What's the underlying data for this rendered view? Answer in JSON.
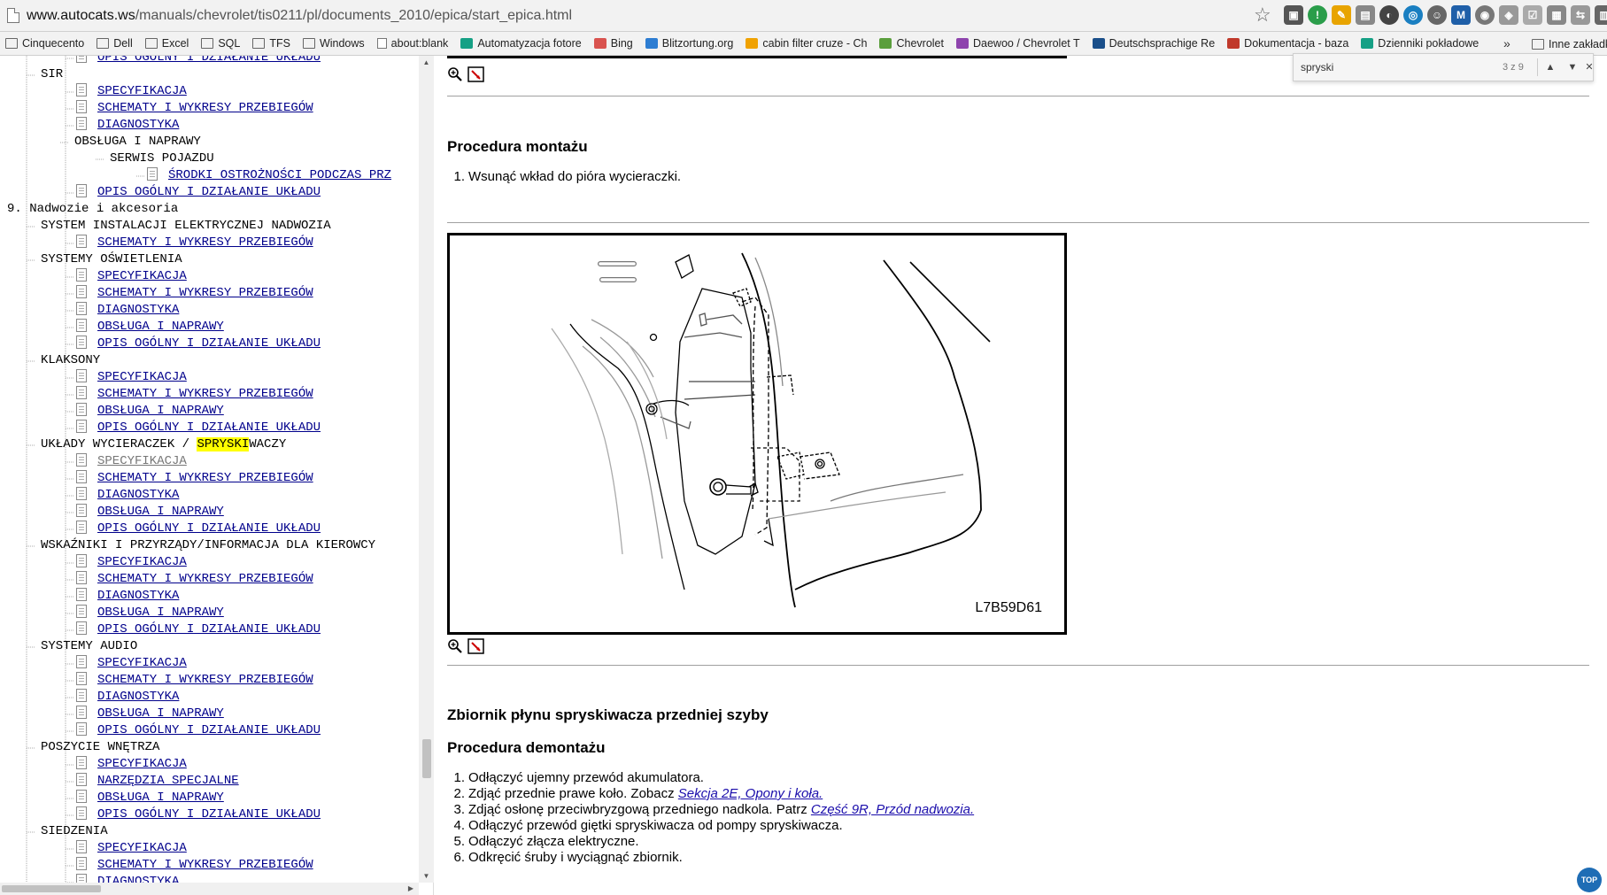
{
  "browser": {
    "url_host": "www.autocats.ws",
    "url_path": "/manuals/chevrolet/tis0211/pl/documents_2010/epica/start_epica.html"
  },
  "bookmarks": {
    "items": [
      {
        "label": "Cinquecento",
        "icon": "folder-icon"
      },
      {
        "label": "Dell",
        "icon": "folder-icon"
      },
      {
        "label": "Excel",
        "icon": "folder-icon"
      },
      {
        "label": "SQL",
        "icon": "folder-icon"
      },
      {
        "label": "TFS",
        "icon": "folder-icon"
      },
      {
        "label": "Windows",
        "icon": "folder-icon"
      },
      {
        "label": "about:blank",
        "icon": "page-icon"
      },
      {
        "label": "Automatyzacja fotore",
        "icon": "site-icon"
      },
      {
        "label": "Bing",
        "icon": "site-icon"
      },
      {
        "label": "Blitzortung.org",
        "icon": "site-icon"
      },
      {
        "label": "cabin filter cruze - Ch",
        "icon": "site-icon"
      },
      {
        "label": "Chevrolet",
        "icon": "site-icon"
      },
      {
        "label": "Daewoo / Chevrolet T",
        "icon": "site-icon"
      },
      {
        "label": "Deutschsprachige Re",
        "icon": "site-icon"
      },
      {
        "label": "Dokumentacja - baza",
        "icon": "site-icon"
      },
      {
        "label": "Dzienniki pokładowe",
        "icon": "site-icon"
      }
    ],
    "more": "»",
    "other": "Inne zakładk"
  },
  "find": {
    "query": "spryski",
    "count": "3 z 9",
    "prev": "▲",
    "next": "▼",
    "close": "✕"
  },
  "tree": {
    "rows": [
      {
        "text": "OPIS OGÓLNY I DZIAŁANIE UKŁADU",
        "link": true
      },
      {
        "text": "SIR",
        "link": false
      },
      {
        "text": "SPECYFIKACJA",
        "link": true
      },
      {
        "text": "SCHEMATY I WYKRESY PRZEBIEGÓW",
        "link": true
      },
      {
        "text": "DIAGNOSTYKA",
        "link": true
      },
      {
        "text": "OBSŁUGA I NAPRAWY",
        "link": false
      },
      {
        "text": "SERWIS POJAZDU",
        "link": false
      },
      {
        "text": "ŚRODKI OSTROŻNOŚCI PODCZAS PRZ",
        "link": true
      },
      {
        "text": "OPIS OGÓLNY I DZIAŁANIE UKŁADU",
        "link": true
      },
      {
        "text": "9. Nadwozie i akcesoria",
        "link": false
      },
      {
        "text": "SYSTEM INSTALACJI ELEKTRYCZNEJ NADWOZIA",
        "link": false
      },
      {
        "text": "SCHEMATY I WYKRESY PRZEBIEGÓW",
        "link": true
      },
      {
        "text": "SYSTEMY OŚWIETLENIA",
        "link": false
      },
      {
        "text": "SPECYFIKACJA",
        "link": true
      },
      {
        "text": "SCHEMATY I WYKRESY PRZEBIEGÓW",
        "link": true
      },
      {
        "text": "DIAGNOSTYKA",
        "link": true
      },
      {
        "text": "OBSŁUGA I NAPRAWY",
        "link": true
      },
      {
        "text": "OPIS OGÓLNY I DZIAŁANIE UKŁADU",
        "link": true
      },
      {
        "text": "KLAKSONY",
        "link": false
      },
      {
        "text": "SPECYFIKACJA",
        "link": true
      },
      {
        "text": "SCHEMATY I WYKRESY PRZEBIEGÓW",
        "link": true
      },
      {
        "text": "OBSŁUGA I NAPRAWY",
        "link": true
      },
      {
        "text": "OPIS OGÓLNY I DZIAŁANIE UKŁADU",
        "link": true
      },
      {
        "text_pre": "UKŁADY WYCIERACZEK / ",
        "text_hl": "SPRYSKI",
        "text_post": "WACZY",
        "link": false
      },
      {
        "text": "SPECYFIKACJA",
        "link": true
      },
      {
        "text": "SCHEMATY I WYKRESY PRZEBIEGÓW",
        "link": true
      },
      {
        "text": "DIAGNOSTYKA",
        "link": true
      },
      {
        "text": "OBSŁUGA I NAPRAWY",
        "link": true
      },
      {
        "text": "OPIS OGÓLNY I DZIAŁANIE UKŁADU",
        "link": true
      },
      {
        "text": "WSKAŹNIKI I PRZYRZĄDY/INFORMACJA DLA KIEROWCY",
        "link": false
      },
      {
        "text": "SPECYFIKACJA",
        "link": true
      },
      {
        "text": "SCHEMATY I WYKRESY PRZEBIEGÓW",
        "link": true
      },
      {
        "text": "DIAGNOSTYKA",
        "link": true
      },
      {
        "text": "OBSŁUGA I NAPRAWY",
        "link": true
      },
      {
        "text": "OPIS OGÓLNY I DZIAŁANIE UKŁADU",
        "link": true
      },
      {
        "text": "SYSTEMY AUDIO",
        "link": false
      },
      {
        "text": "SPECYFIKACJA",
        "link": true
      },
      {
        "text": "SCHEMATY I WYKRESY PRZEBIEGÓW",
        "link": true
      },
      {
        "text": "DIAGNOSTYKA",
        "link": true
      },
      {
        "text": "OBSŁUGA I NAPRAWY",
        "link": true
      },
      {
        "text": "OPIS OGÓLNY I DZIAŁANIE UKŁADU",
        "link": true
      },
      {
        "text": "POSZYCIE WNĘTRZA",
        "link": false
      },
      {
        "text": "SPECYFIKACJA",
        "link": true
      },
      {
        "text": "NARZĘDZIA SPECJALNE",
        "link": true
      },
      {
        "text": "OBSŁUGA I NAPRAWY",
        "link": true
      },
      {
        "text": "OPIS OGÓLNY I DZIAŁANIE UKŁADU",
        "link": true
      },
      {
        "text": "SIEDZENIA",
        "link": false
      },
      {
        "text": "SPECYFIKACJA",
        "link": true
      },
      {
        "text": "SCHEMATY I WYKRESY PRZEBIEGÓW",
        "link": true
      },
      {
        "text": "DIAGNOSTYKA",
        "link": true
      }
    ]
  },
  "content": {
    "heading1": "Procedura montażu",
    "steps1": [
      {
        "num": "1.",
        "text": "Wsunąć wkład do pióra wycieraczki."
      }
    ],
    "figure_code": "L7B59D61",
    "heading2": "Zbiornik płynu spryskiwacza przedniej szyby",
    "heading3": "Procedura demontażu",
    "steps2": [
      {
        "num": "1.",
        "text": "Odłączyć ujemny przewód akumulatora."
      },
      {
        "num": "2.",
        "text": "Zdjąć przednie prawe koło. Zobacz ",
        "link": "Sekcja 2E, Opony i koła.",
        "after": ""
      },
      {
        "num": "3.",
        "text": "Zdjąć osłonę przeciwbryzgową przedniego nadkola. Patrz ",
        "link": "Część 9R, Przód nadwozia.",
        "after": ""
      },
      {
        "num": "4.",
        "text": "Odłączyć przewód giętki spryskiwacza od pompy spryskiwacza."
      },
      {
        "num": "5.",
        "text": "Odłączyć złącza elektryczne."
      },
      {
        "num": "6.",
        "text": "Odkręcić śruby i wyciągnąć zbiornik."
      }
    ]
  },
  "top_button": "TOP"
}
